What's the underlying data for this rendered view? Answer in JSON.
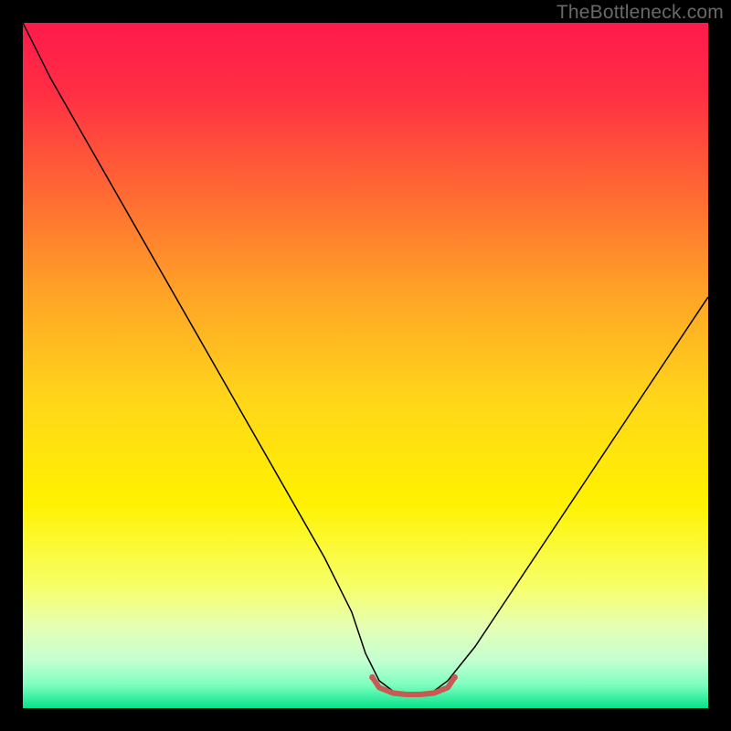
{
  "watermark": "TheBottleneck.com",
  "chart_data": {
    "type": "line",
    "title": "",
    "xlabel": "",
    "ylabel": "",
    "xlim": [
      0,
      100
    ],
    "ylim": [
      0,
      100
    ],
    "grid": false,
    "legend": false,
    "background_gradient_stops": [
      {
        "offset": 0.0,
        "color": "#ff1a4b"
      },
      {
        "offset": 0.1,
        "color": "#ff2e44"
      },
      {
        "offset": 0.25,
        "color": "#ff6a33"
      },
      {
        "offset": 0.4,
        "color": "#ffa526"
      },
      {
        "offset": 0.55,
        "color": "#ffd61a"
      },
      {
        "offset": 0.7,
        "color": "#fff200"
      },
      {
        "offset": 0.82,
        "color": "#f7ff66"
      },
      {
        "offset": 0.88,
        "color": "#e6ffb3"
      },
      {
        "offset": 0.93,
        "color": "#c4ffd1"
      },
      {
        "offset": 0.965,
        "color": "#80ffc0"
      },
      {
        "offset": 1.0,
        "color": "#06e38a"
      }
    ],
    "series": [
      {
        "name": "bottleneck-curve",
        "color": "#000000",
        "stroke_width": 1.5,
        "x": [
          0,
          4,
          8,
          12,
          16,
          20,
          24,
          28,
          32,
          36,
          40,
          44,
          48,
          50,
          52,
          54,
          56,
          58,
          60,
          62,
          66,
          70,
          74,
          78,
          82,
          86,
          90,
          94,
          98,
          100
        ],
        "y": [
          100,
          92,
          85,
          78,
          71,
          64,
          57,
          50,
          43,
          36,
          29,
          22,
          14,
          8,
          4,
          2.5,
          2,
          2,
          2.5,
          4,
          9,
          15,
          21,
          27,
          33,
          39,
          45,
          51,
          57,
          60
        ]
      },
      {
        "name": "optimal-marker",
        "color": "#c85a54",
        "stroke_width": 6,
        "linecap": "round",
        "x": [
          51,
          52,
          54,
          56,
          58,
          60,
          62,
          63
        ],
        "y": [
          4.5,
          3,
          2.2,
          2,
          2,
          2.2,
          3,
          4.5
        ]
      }
    ],
    "optimal_marker_endpoints": {
      "left": {
        "x": 51,
        "y": 4.5,
        "r": 3.4,
        "color": "#c85a54"
      },
      "right": {
        "x": 63,
        "y": 4.5,
        "r": 3.4,
        "color": "#c85a54"
      }
    }
  }
}
